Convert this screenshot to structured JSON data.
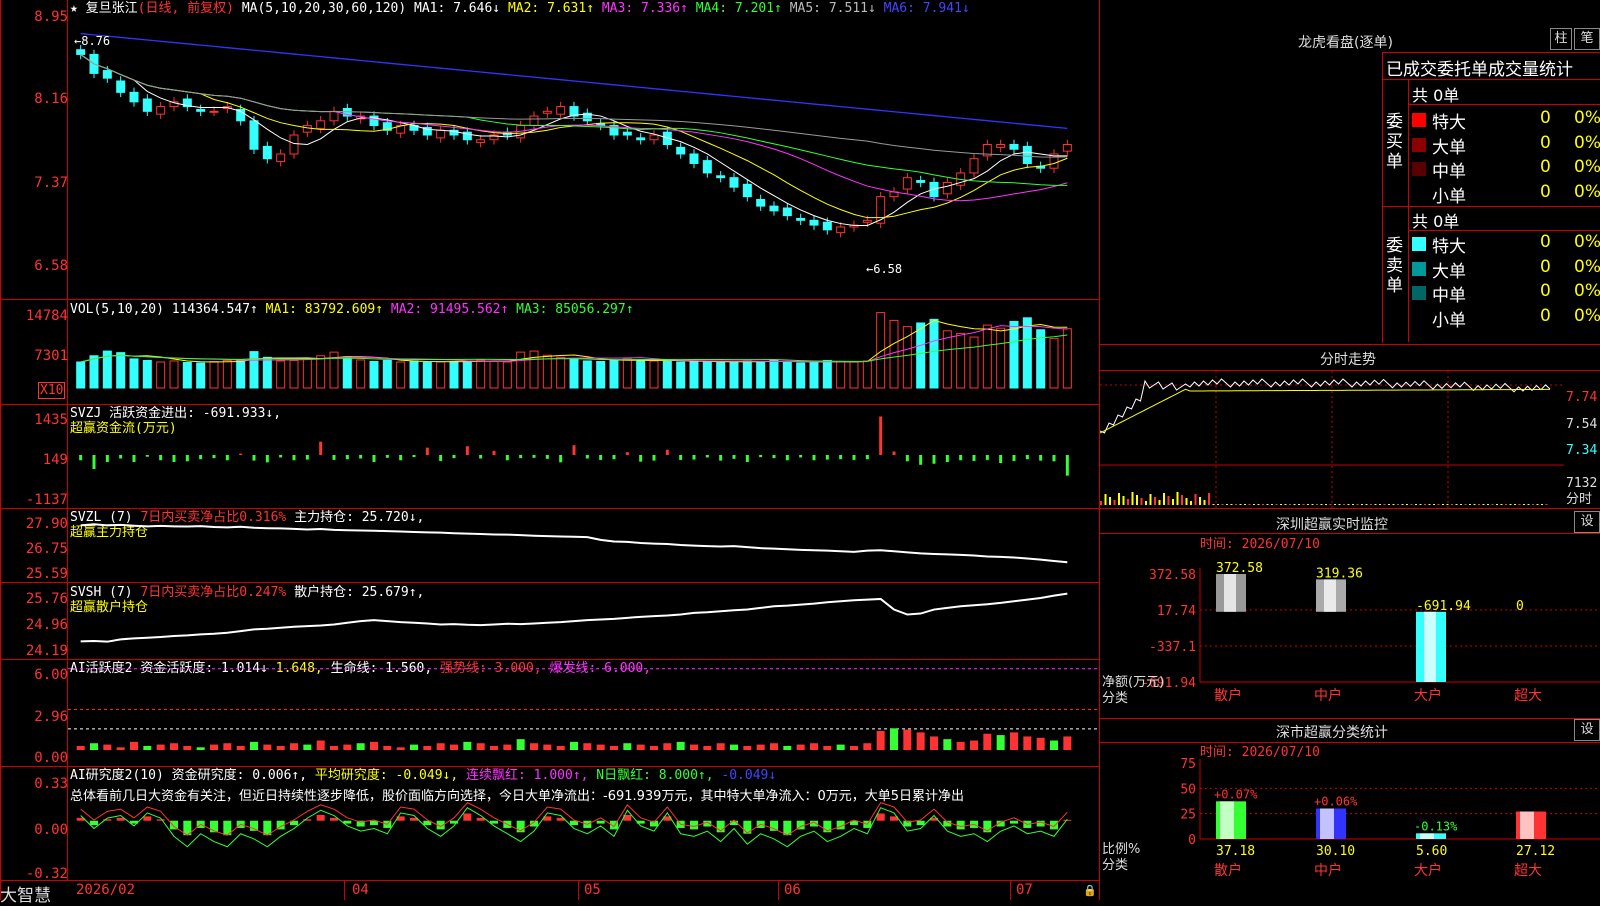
{
  "colors": {
    "up": "#ff3333",
    "down": "#33ffff",
    "frame": "#cc0000",
    "ma1": "#ffffff",
    "ma2": "#ffff00",
    "ma3": "#ff33ff",
    "ma4": "#33ff33",
    "ma5": "#999999",
    "ma6": "#3333ff"
  },
  "kline": {
    "title": "复旦张江",
    "period": "(日线, 前复权)",
    "ma_text": "MA(5,10,20,30,60,120)",
    "ma1": "MA1: 7.646↓",
    "ma2": "MA2: 7.631↑",
    "ma3": "MA3: 7.336↑",
    "ma4": "MA4: 7.201↑",
    "ma5": "MA5: 7.511↓",
    "ma6": "MA6: 7.941↓",
    "y_labels": [
      "8.95",
      "8.16",
      "7.37",
      "6.58"
    ],
    "high_mark": "8.76",
    "low_mark": "6.58",
    "closes": [
      8.7,
      8.5,
      8.45,
      8.3,
      8.2,
      8.1,
      8.15,
      8.2,
      8.15,
      8.1,
      8.1,
      8.15,
      8.0,
      7.7,
      7.6,
      7.65,
      7.85,
      7.95,
      8.0,
      8.1,
      8.05,
      8.05,
      7.95,
      7.9,
      7.95,
      7.9,
      7.85,
      7.9,
      7.85,
      7.8,
      7.8,
      7.85,
      7.85,
      7.95,
      8.05,
      8.1,
      8.15,
      8.05,
      8.0,
      7.95,
      7.85,
      7.85,
      7.8,
      7.85,
      7.75,
      7.65,
      7.55,
      7.45,
      7.4,
      7.3,
      7.2,
      7.1,
      7.05,
      7.0,
      6.95,
      6.9,
      6.85,
      6.88,
      6.9,
      6.95,
      7.2,
      7.25,
      7.4,
      7.35,
      7.2,
      7.35,
      7.45,
      7.6,
      7.75,
      7.75,
      7.7,
      7.55,
      7.5,
      7.65,
      7.75
    ]
  },
  "vol": {
    "label": "VOL(5,10,20)",
    "value": "114364.547↑",
    "ma1": "MA1: 83792.609↑",
    "ma2": "MA2: 91495.562↑",
    "ma3": "MA3: 85056.297↑",
    "y_labels": [
      "14784",
      "7301"
    ],
    "unit": "X10",
    "values": [
      5000,
      6200,
      7100,
      6800,
      5600,
      5300,
      5000,
      5200,
      4900,
      4800,
      5100,
      5300,
      5400,
      7000,
      5900,
      5200,
      5300,
      5600,
      6200,
      6900,
      6000,
      5400,
      5100,
      5300,
      5000,
      5200,
      4900,
      5000,
      5100,
      5200,
      5400,
      5100,
      5000,
      6900,
      7100,
      6300,
      5900,
      5500,
      5200,
      5100,
      5300,
      5600,
      5400,
      5200,
      5100,
      5000,
      5200,
      5100,
      4900,
      5000,
      5200,
      5100,
      5300,
      5000,
      4800,
      4900,
      5300,
      5100,
      5000,
      5200,
      14500,
      13000,
      11800,
      12500,
      13200,
      11000,
      10500,
      9800,
      12100,
      11500,
      12800,
      13500,
      11200,
      9500,
      11400
    ]
  },
  "svzj": {
    "label": "SVZJ",
    "text1": "活跃资金进出: -691.933↓,",
    "text2": "超赢资金流(万元)",
    "y_labels": [
      "1435",
      "149",
      "-1137"
    ],
    "values": [
      -150,
      -400,
      -200,
      -100,
      -200,
      -50,
      -150,
      -200,
      -180,
      -120,
      -90,
      -150,
      40,
      -160,
      -210,
      -70,
      -150,
      -130,
      380,
      -140,
      -120,
      -100,
      -200,
      -80,
      -150,
      -60,
      210,
      -170,
      -90,
      250,
      -100,
      120,
      -150,
      -90,
      -80,
      -110,
      -210,
      280,
      -100,
      -140,
      -120,
      80,
      -190,
      -160,
      150,
      -140,
      -130,
      -70,
      -160,
      -110,
      -200,
      -60,
      -90,
      -150,
      -70,
      -150,
      -130,
      -120,
      -140,
      -120,
      1100,
      100,
      -180,
      -280,
      -250,
      -200,
      -150,
      -170,
      -140,
      -230,
      -170,
      -120,
      -160,
      -180,
      -590
    ]
  },
  "svzl": {
    "label": "SVZL (7)",
    "text1": "7日内买卖净占比0.316%",
    "text2": "主力持仓: 25.720↓,",
    "text3": "超赢主力持仓",
    "y_labels": [
      "27.90",
      "26.75",
      "25.59"
    ],
    "values": [
      27.5,
      27.55,
      27.5,
      27.52,
      27.48,
      27.45,
      27.47,
      27.45,
      27.44,
      27.46,
      27.42,
      27.4,
      27.43,
      27.38,
      27.36,
      27.35,
      27.33,
      27.3,
      27.32,
      27.28,
      27.26,
      27.25,
      27.24,
      27.22,
      27.2,
      27.18,
      27.16,
      27.15,
      27.12,
      27.1,
      27.08,
      27.06,
      27.05,
      27.03,
      27.0,
      26.98,
      26.96,
      26.95,
      26.93,
      26.8,
      26.72,
      26.7,
      26.65,
      26.62,
      26.6,
      26.55,
      26.52,
      26.5,
      26.48,
      26.5,
      26.45,
      26.4,
      26.38,
      26.35,
      26.32,
      26.3,
      26.28,
      26.25,
      26.22,
      26.28,
      26.3,
      26.25,
      26.2,
      26.15,
      26.12,
      26.1,
      26.08,
      26.05,
      26.0,
      25.98,
      25.95,
      25.9,
      25.85,
      25.78,
      25.72
    ]
  },
  "svsh": {
    "label": "SVSH (7)",
    "text1": "7日内买卖净占比0.247%",
    "text2": "散户持仓: 25.679↑,",
    "text3": "超赢散户持仓",
    "y_labels": [
      "25.76",
      "24.96",
      "24.19"
    ],
    "values": [
      24.24,
      24.25,
      24.23,
      24.3,
      24.33,
      24.35,
      24.37,
      24.4,
      24.42,
      24.45,
      24.47,
      24.5,
      24.55,
      24.6,
      24.62,
      24.65,
      24.68,
      24.7,
      24.72,
      24.75,
      24.8,
      24.85,
      24.88,
      24.85,
      24.82,
      24.8,
      24.78,
      24.75,
      24.76,
      24.74,
      24.73,
      24.75,
      24.77,
      24.76,
      24.78,
      24.8,
      24.82,
      24.85,
      24.88,
      24.9,
      24.92,
      24.95,
      24.98,
      25.0,
      25.02,
      25.05,
      25.1,
      25.12,
      25.15,
      25.18,
      25.2,
      25.25,
      25.3,
      25.32,
      25.35,
      25.38,
      25.42,
      25.45,
      25.48,
      25.5,
      25.52,
      25.2,
      25.05,
      25.08,
      25.2,
      25.25,
      25.3,
      25.33,
      25.36,
      25.4,
      25.45,
      25.5,
      25.55,
      25.62,
      25.68
    ]
  },
  "ai_active": {
    "label": "AI活跃度2",
    "text1": "资金活跃度: 1.014↓",
    "text2": "1.648,",
    "text3": "生命线: 1.560,",
    "text4": "强势线: 3.000,",
    "text5": "爆发线: 6.000,",
    "y_labels": [
      "6.00",
      "2.96",
      "0.00"
    ],
    "values": [
      0.3,
      0.5,
      0.4,
      0.2,
      0.6,
      0.3,
      0.4,
      0.5,
      0.3,
      0.2,
      0.4,
      0.5,
      0.3,
      0.6,
      0.4,
      0.3,
      0.5,
      0.4,
      0.7,
      0.3,
      0.4,
      0.5,
      0.6,
      0.3,
      0.2,
      0.4,
      0.3,
      0.5,
      0.4,
      0.6,
      0.5,
      0.3,
      0.4,
      0.8,
      0.5,
      0.4,
      0.3,
      0.6,
      0.5,
      0.4,
      0.3,
      0.5,
      0.4,
      0.3,
      0.5,
      0.6,
      0.4,
      0.3,
      0.5,
      0.4,
      0.3,
      0.4,
      0.5,
      0.3,
      0.4,
      0.5,
      0.3,
      0.4,
      0.3,
      0.5,
      1.4,
      1.6,
      1.5,
      1.3,
      1.0,
      0.8,
      0.6,
      0.7,
      1.2,
      1.1,
      1.3,
      1.0,
      0.9,
      0.7,
      1.0
    ]
  },
  "ai_research": {
    "label": "AI研究度2(10)",
    "text1": "资金研究度: 0.006↑,",
    "text2": "平均研究度: -0.049↓,",
    "text3": "连续飘红: 1.000↑,",
    "text4": "N日飘红: 8.000↑,",
    "text5": "-0.049↓",
    "comment": "总体看前几日大资金有关注，但近日持续性逐步降低，股价面临方向选择，今日大单净流出：-691.939万元，其中特大单净流入：0万元，大单5日累计净出",
    "y_labels": [
      "0.33",
      "0.00",
      "-0.32"
    ],
    "values": [
      0.02,
      -0.03,
      0.01,
      0.02,
      -0.02,
      0.03,
      0.01,
      -0.06,
      -0.1,
      -0.05,
      -0.08,
      -0.1,
      -0.05,
      -0.07,
      -0.1,
      -0.06,
      -0.03,
      0.01,
      0.04,
      0.02,
      -0.02,
      -0.04,
      -0.03,
      -0.05,
      0.03,
      0.02,
      -0.03,
      -0.06,
      -0.02,
      0.05,
      0.02,
      -0.02,
      -0.05,
      -0.08,
      -0.04,
      0.03,
      0.02,
      -0.03,
      -0.05,
      -0.02,
      -0.06,
      0.04,
      -0.02,
      -0.04,
      0.03,
      -0.05,
      -0.06,
      -0.04,
      -0.08,
      -0.03,
      -0.09,
      -0.05,
      -0.07,
      -0.1,
      -0.06,
      -0.04,
      -0.08,
      -0.06,
      -0.03,
      -0.05,
      0.05,
      0.03,
      -0.04,
      -0.03,
      0.02,
      -0.04,
      -0.06,
      -0.05,
      -0.08,
      -0.04,
      -0.02,
      -0.05,
      -0.04,
      -0.06,
      0.006
    ]
  },
  "time_axis": {
    "labels": [
      "2026/02",
      "04",
      "05",
      "06",
      "07"
    ]
  },
  "brand": "大智慧",
  "lhb": {
    "title": "龙虎看盘(逐单)",
    "btn1": "柱",
    "btn2": "笔",
    "header": "已成交委托单成交量统计",
    "buy_label": "委买单",
    "sell_label": "委卖单",
    "buy_total": "共 0单",
    "sell_total": "共 0单",
    "rows": [
      {
        "name": "特大",
        "value": "0",
        "pct": "0%"
      },
      {
        "name": "大单",
        "value": "0",
        "pct": "0%"
      },
      {
        "name": "中单",
        "value": "0",
        "pct": "0%"
      },
      {
        "name": "小单",
        "value": "0",
        "pct": "0%"
      }
    ]
  },
  "intraday": {
    "title": "分时走势",
    "prices": [
      "7.74",
      "7.54",
      "7.34"
    ],
    "vol_label": "7132",
    "unit": "分时"
  },
  "sz_monitor": {
    "title": "深圳超赢实时监控",
    "btn": "设",
    "time": "时间: 2026/07/10",
    "y_labels": [
      "372.58",
      "17.74",
      "-337.1",
      "-691.94"
    ],
    "cats": [
      "散户",
      "中户",
      "大户",
      "超大"
    ],
    "values": [
      372.58,
      319.36,
      -691.94,
      0
    ],
    "value_labels": [
      "372.58",
      "319.36",
      "-691.94",
      "0"
    ],
    "unit": "净额(万元)",
    "cat_label": "分类"
  },
  "sz_class": {
    "title": "深市超赢分类统计",
    "btn": "设",
    "time": "时间: 2026/07/10",
    "y_labels": [
      "75",
      "50",
      "25",
      "0"
    ],
    "cats": [
      "散户",
      "中户",
      "大户",
      "超大"
    ],
    "values": [
      37.18,
      30.1,
      5.6,
      27.12
    ],
    "value_labels": [
      "37.18",
      "30.10",
      "5.60",
      "27.12"
    ],
    "changes": [
      "+0.07%",
      "+0.06%",
      "-0.13%",
      ""
    ],
    "unit": "比例%",
    "cat_label": "分类"
  }
}
